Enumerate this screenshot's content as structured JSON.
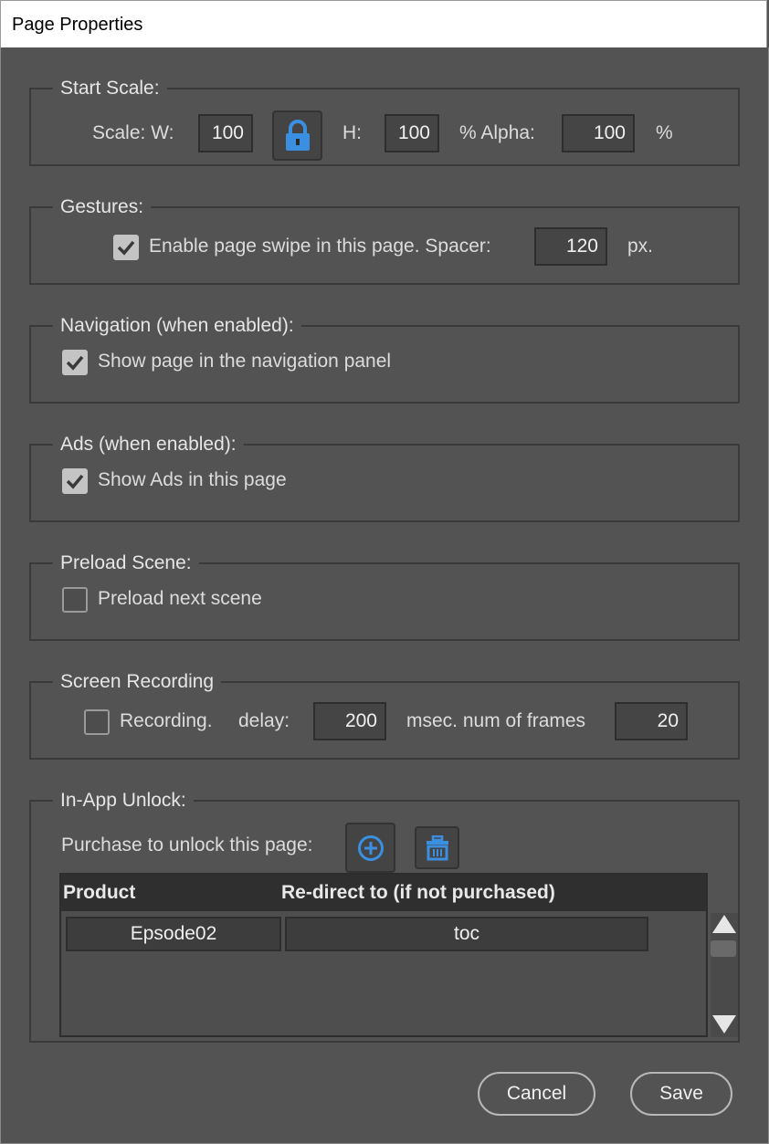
{
  "window": {
    "title": "Page Properties"
  },
  "start_scale": {
    "legend": "Start Scale:",
    "scale_w_label": "Scale: W:",
    "w_value": "100",
    "h_label": "H:",
    "h_value": "100",
    "alpha_label": "% Alpha:",
    "alpha_value": "100",
    "percent_label": "%",
    "lock_icon": "lock-icon"
  },
  "gestures": {
    "legend": "Gestures:",
    "swipe_label": "Enable page swipe in this page. Spacer:",
    "swipe_checked": true,
    "spacer_value": "120",
    "unit_label": "px."
  },
  "navigation": {
    "legend": "Navigation (when enabled):",
    "show_label": "Show page in the navigation panel",
    "checked": true
  },
  "ads": {
    "legend": "Ads (when enabled):",
    "show_label": "Show Ads in this page",
    "checked": true
  },
  "preload": {
    "legend": "Preload Scene:",
    "label": "Preload next scene",
    "checked": false
  },
  "recording": {
    "legend": "Screen Recording",
    "label": "Recording.",
    "checked": false,
    "delay_label": "delay:",
    "delay_value": "200",
    "frames_label": "msec. num of frames",
    "frames_value": "20"
  },
  "in_app": {
    "legend": "In-App Unlock:",
    "purchase_label": "Purchase to unlock this page:",
    "add_icon": "plus-circle-icon",
    "delete_icon": "trash-icon",
    "columns": [
      "Product",
      "Re-direct to (if not purchased)"
    ],
    "rows": [
      {
        "product": "Epsode02",
        "redirect": "toc"
      }
    ]
  },
  "buttons": {
    "cancel": "Cancel",
    "save": "Save"
  },
  "colors": {
    "background": "#535353",
    "accent_blue": "#3b8fe0"
  }
}
